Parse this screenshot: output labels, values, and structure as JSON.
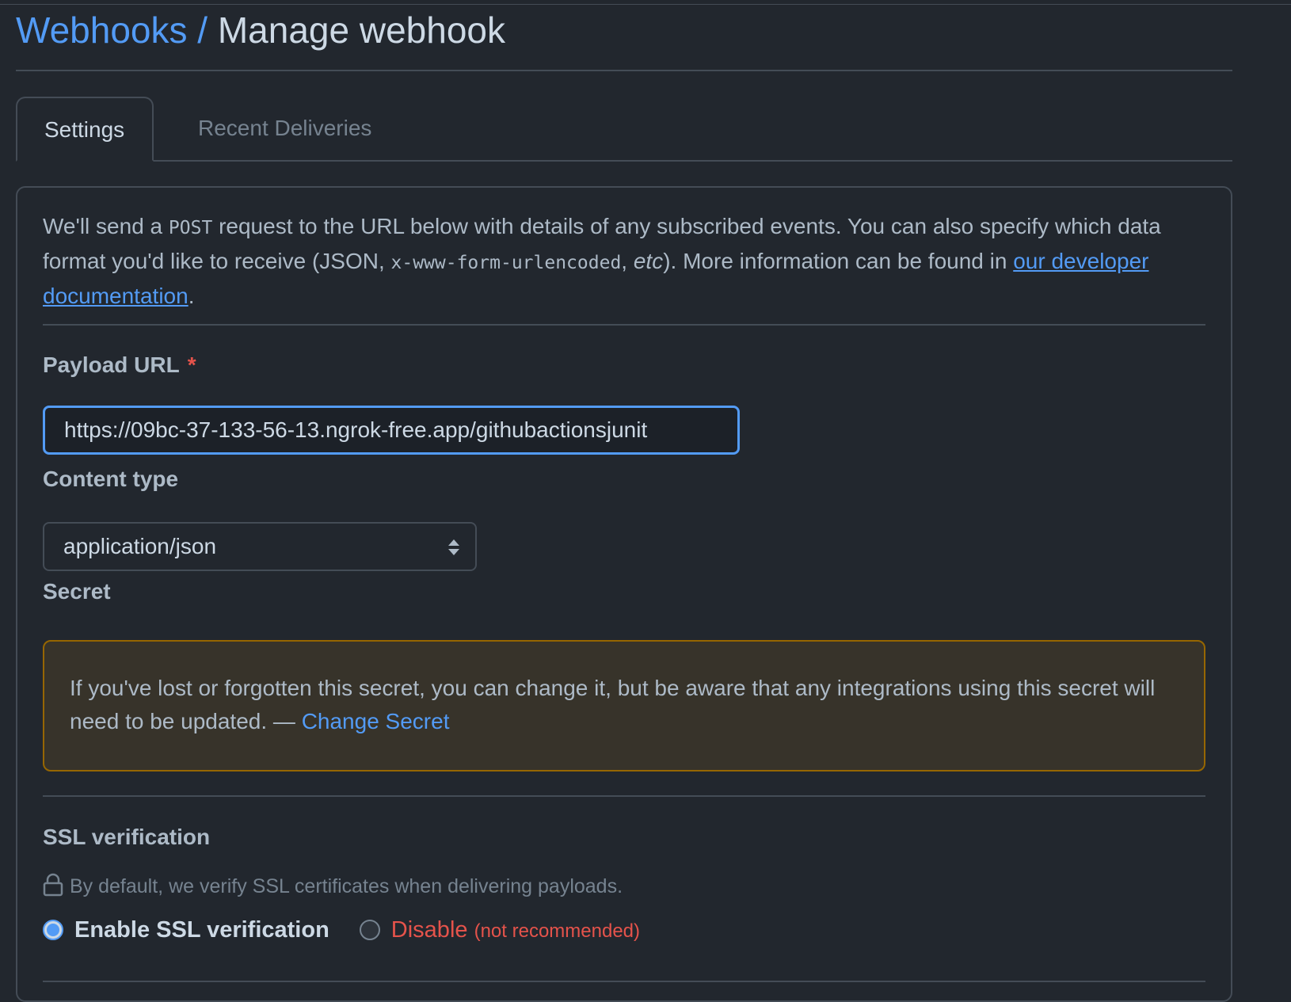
{
  "header": {
    "breadcrumb_link": "Webhooks",
    "separator": "/",
    "current": "Manage webhook"
  },
  "tabs": [
    {
      "label": "Settings",
      "active": true
    },
    {
      "label": "Recent Deliveries",
      "active": false
    }
  ],
  "intro": {
    "part1": "We'll send a ",
    "code1": "POST",
    "part2": " request to the URL below with details of any subscribed events. You can also specify which data format you'd like to receive (JSON, ",
    "code2": "x-www-form-urlencoded",
    "part3": ", ",
    "em": "etc",
    "part4": "). More information can be found in ",
    "link": "our developer documentation",
    "part5": "."
  },
  "payload_url": {
    "label": "Payload URL",
    "required_mark": "*",
    "value": "https://09bc-37-133-56-13.ngrok-free.app/githubactionsjunit"
  },
  "content_type": {
    "label": "Content type",
    "selected": "application/json"
  },
  "secret": {
    "label": "Secret",
    "message": "If you've lost or forgotten this secret, you can change it, but be aware that any integrations using this secret will need to be updated. — ",
    "link": "Change Secret"
  },
  "ssl": {
    "label": "SSL verification",
    "description": "By default, we verify SSL certificates when delivering payloads.",
    "enable_label": "Enable SSL verification",
    "disable_label": "Disable",
    "disable_note": "(not recommended)",
    "selected": "enable"
  },
  "colors": {
    "background": "#22272e",
    "accent": "#539bf5",
    "danger": "#e5534b",
    "warning_border": "#966600"
  }
}
